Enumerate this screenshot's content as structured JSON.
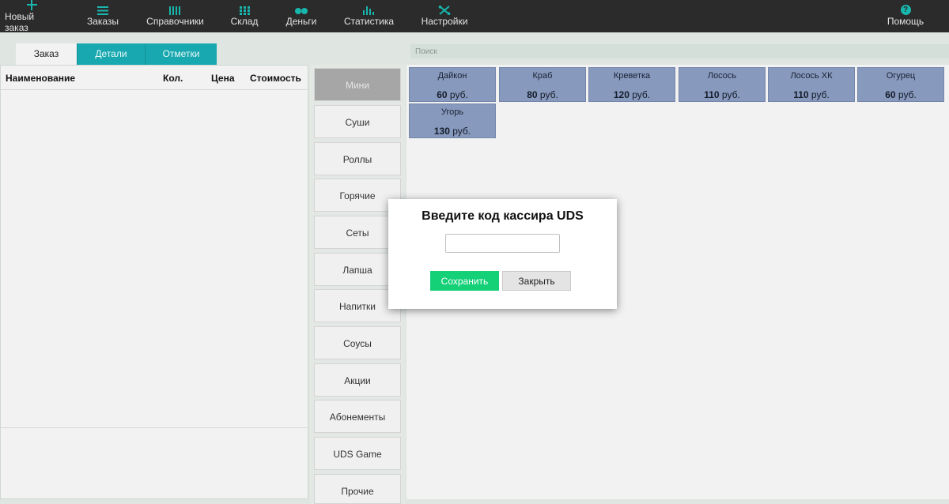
{
  "nav": {
    "new_order": "Новый заказ",
    "orders": "Заказы",
    "references": "Справочники",
    "warehouse": "Склад",
    "money": "Деньги",
    "statistics": "Статистика",
    "settings": "Настройки",
    "help": "Помощь",
    "help_glyph": "?"
  },
  "tabs": [
    "Заказ",
    "Детали",
    "Отметки"
  ],
  "order_table": {
    "columns": [
      "Наименование",
      "Кол.",
      "Цена",
      "Стоимость"
    ]
  },
  "categories": [
    "Мини",
    "Суши",
    "Роллы",
    "Горячие",
    "Сеты",
    "Лапша",
    "Напитки",
    "Соусы",
    "Акции",
    "Абонементы",
    "UDS Game",
    "Прочие"
  ],
  "search": {
    "placeholder": "Поиск"
  },
  "products": [
    {
      "name": "Дайкон",
      "price": "60",
      "currency": "руб."
    },
    {
      "name": "Краб",
      "price": "80",
      "currency": "руб."
    },
    {
      "name": "Креветка",
      "price": "120",
      "currency": "руб."
    },
    {
      "name": "Лосось",
      "price": "110",
      "currency": "руб."
    },
    {
      "name": "Лосось ХК",
      "price": "110",
      "currency": "руб."
    },
    {
      "name": "Огурец",
      "price": "60",
      "currency": "руб."
    },
    {
      "name": "Угорь",
      "price": "130",
      "currency": "руб."
    }
  ],
  "modal": {
    "title": "Введите код кассира UDS",
    "input_value": "",
    "save_label": "Сохранить",
    "close_label": "Закрыть"
  },
  "colors": {
    "topbar": "#2b2b2b",
    "accent": "#18b6ac",
    "tab_inactive": "#18a9b0",
    "product_tile": "#8799bd",
    "save_button": "#14d077"
  }
}
